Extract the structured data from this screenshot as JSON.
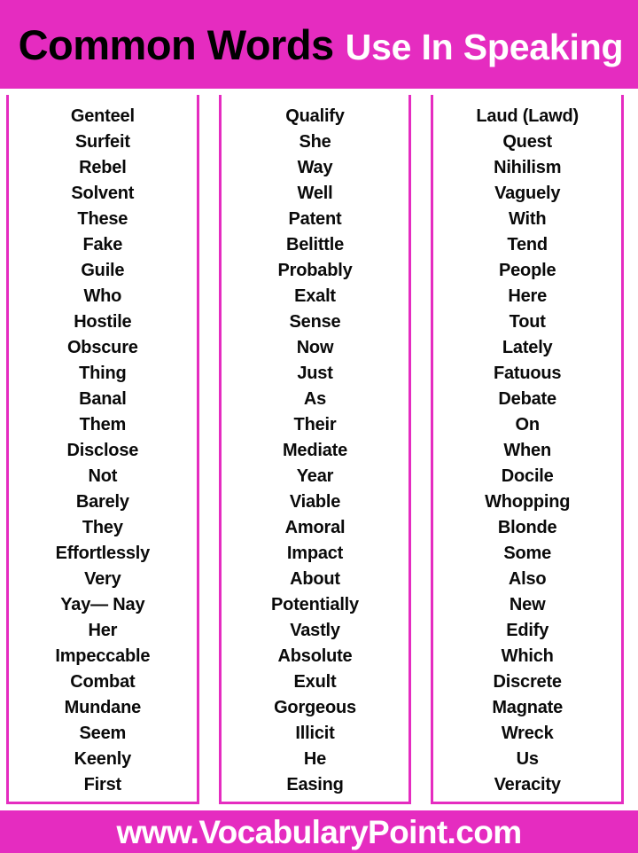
{
  "header": {
    "title_primary": "Common Words",
    "title_secondary": "Use In Speaking",
    "background_color": "#e52cc0",
    "primary_color": "#000000",
    "secondary_color": "#ffffff"
  },
  "columns": [
    {
      "id": "column-1",
      "words": [
        "Genteel",
        "Surfeit",
        "Rebel",
        "Solvent",
        "These",
        "Fake",
        "Guile",
        "Who",
        "Hostile",
        "Obscure",
        "Thing",
        "Banal",
        "Them",
        "Disclose",
        "Not",
        "Barely",
        "They",
        "Effortlessly",
        "Very",
        "Yay— Nay",
        "Her",
        "Impeccable",
        "Combat",
        "Mundane",
        "Seem",
        "Keenly",
        "First"
      ]
    },
    {
      "id": "column-2",
      "words": [
        "Qualify",
        "She",
        "Way",
        "Well",
        "Patent",
        "Belittle",
        "Probably",
        "Exalt",
        "Sense",
        "Now",
        "Just",
        "As",
        "Their",
        "Mediate",
        "Year",
        "Viable",
        "Amoral",
        "Impact",
        "About",
        "Potentially",
        "Vastly",
        "Absolute",
        "Exult",
        "Gorgeous",
        "Illicit",
        "He",
        "Easing"
      ]
    },
    {
      "id": "column-3",
      "words": [
        "Laud (Lawd)",
        "Quest",
        "Nihilism",
        "Vaguely",
        "With",
        "Tend",
        "People",
        "Here",
        "Tout",
        "Lately",
        "Fatuous",
        "Debate",
        "On",
        "When",
        "Docile",
        "Whopping",
        "Blonde",
        "Some",
        "Also",
        "New",
        "Edify",
        "Which",
        "Discrete",
        "Magnate",
        "Wreck",
        "Us",
        "Veracity"
      ]
    }
  ],
  "footer": {
    "website": "www.VocabularyPoint.com",
    "background_color": "#e52cc0",
    "text_color": "#ffffff"
  }
}
